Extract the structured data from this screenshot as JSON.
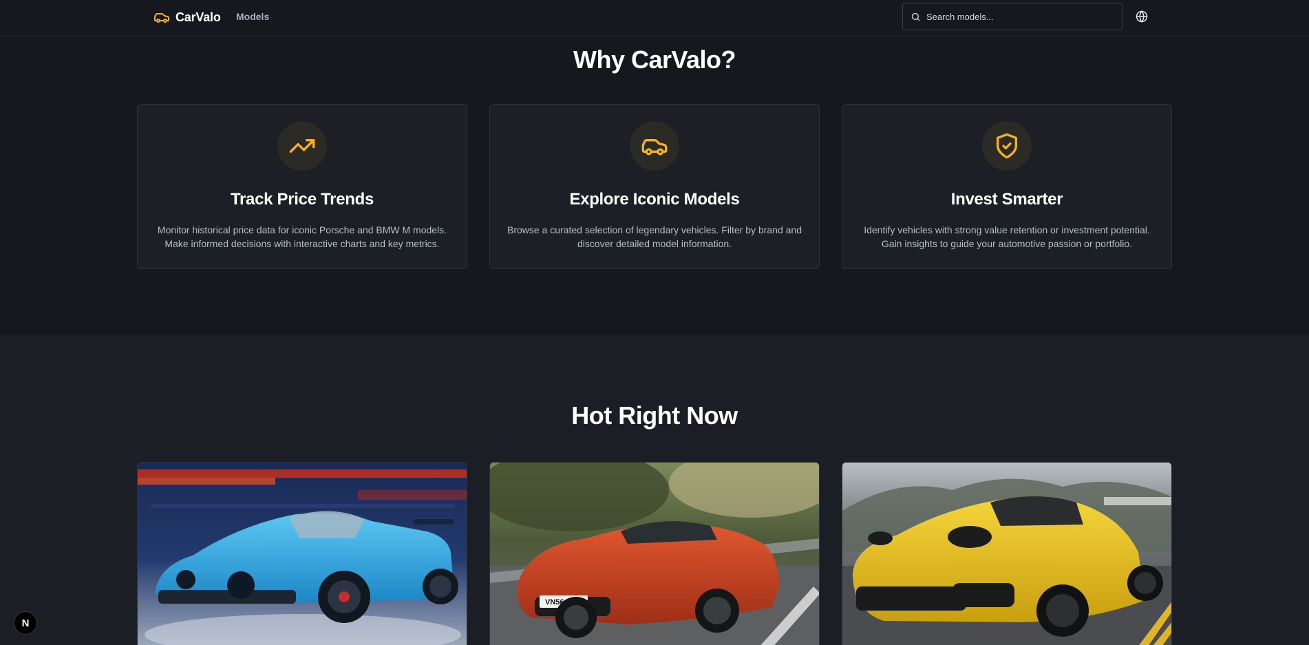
{
  "header": {
    "logo_text": "CarValo",
    "nav_models": "Models",
    "search_placeholder": "Search models..."
  },
  "why": {
    "title": "Why CarValo?",
    "features": [
      {
        "icon": "trending-up-icon",
        "title": "Track Price Trends",
        "description": "Monitor historical price data for iconic Porsche and BMW M models. Make informed decisions with interactive charts and key metrics."
      },
      {
        "icon": "car-icon",
        "title": "Explore Iconic Models",
        "description": "Browse a curated selection of legendary vehicles. Filter by brand and discover detailed model information."
      },
      {
        "icon": "shield-check-icon",
        "title": "Invest Smarter",
        "description": "Identify vehicles with strong value retention or investment potential. Gain insights to guide your automotive passion or portfolio."
      }
    ]
  },
  "hot": {
    "title": "Hot Right Now",
    "cards": [
      {
        "image": "blue-porsche-gt3",
        "plate": ""
      },
      {
        "image": "red-aston-martin-vantage",
        "plate": "VN56 AML"
      },
      {
        "image": "yellow-porsche-cayman",
        "plate": ""
      }
    ]
  },
  "next_badge": "N",
  "colors": {
    "accent": "#f5b324",
    "background": "#16181d",
    "card": "#1c1f25"
  }
}
